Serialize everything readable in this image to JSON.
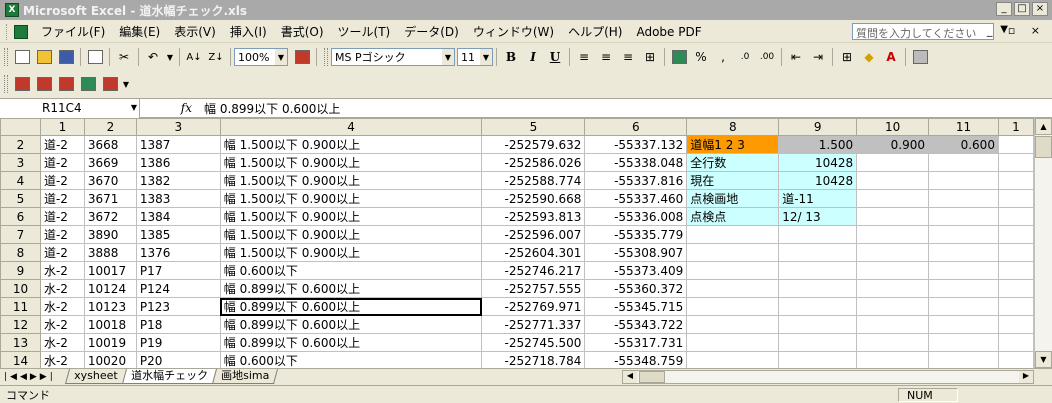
{
  "window": {
    "title": "Microsoft Excel - 道水幅チェック.xls",
    "app_icon": "excel-icon"
  },
  "menu": {
    "items": [
      "ファイル(F)",
      "編集(E)",
      "表示(V)",
      "挿入(I)",
      "書式(O)",
      "ツール(T)",
      "データ(D)",
      "ウィンドウ(W)",
      "ヘルプ(H)",
      "Adobe PDF"
    ],
    "help_placeholder": "質問を入力してください"
  },
  "toolbar": {
    "zoom": "100%",
    "font_name": "MS Pゴシック",
    "font_size": "11",
    "bold": "B",
    "italic": "I",
    "underline": "U",
    "percent": "%",
    "comma": ","
  },
  "formula_bar": {
    "name_box": "R11C4",
    "fx": "fx",
    "value": "幅 0.899以下 0.600以上"
  },
  "grid": {
    "col_headers": [
      "1",
      "2",
      "3",
      "4",
      "5",
      "6",
      "8",
      "9",
      "10",
      "11",
      "1"
    ],
    "rows": [
      {
        "n": "2",
        "c1": "道-2",
        "c2": "3668",
        "c3": "1387",
        "c4": "幅  1.500以下  0.900以上",
        "c5": "-252579.632",
        "c6": "-55337.132"
      },
      {
        "n": "3",
        "c1": "道-2",
        "c2": "3669",
        "c3": "1386",
        "c4": "幅  1.500以下  0.900以上",
        "c5": "-252586.026",
        "c6": "-55338.048"
      },
      {
        "n": "4",
        "c1": "道-2",
        "c2": "3670",
        "c3": "1382",
        "c4": "幅  1.500以下  0.900以上",
        "c5": "-252588.774",
        "c6": "-55337.816"
      },
      {
        "n": "5",
        "c1": "道-2",
        "c2": "3671",
        "c3": "1383",
        "c4": "幅  1.500以下  0.900以上",
        "c5": "-252590.668",
        "c6": "-55337.460"
      },
      {
        "n": "6",
        "c1": "道-2",
        "c2": "3672",
        "c3": "1384",
        "c4": "幅  1.500以下  0.900以上",
        "c5": "-252593.813",
        "c6": "-55336.008"
      },
      {
        "n": "7",
        "c1": "道-2",
        "c2": "3890",
        "c3": "1385",
        "c4": "幅  1.500以下  0.900以上",
        "c5": "-252596.007",
        "c6": "-55335.779"
      },
      {
        "n": "8",
        "c1": "道-2",
        "c2": "3888",
        "c3": "1376",
        "c4": "幅  1.500以下  0.900以上",
        "c5": "-252604.301",
        "c6": "-55308.907"
      },
      {
        "n": "9",
        "c1": "水-2",
        "c2": "10017",
        "c3": "P17",
        "c4": "幅  0.600以下",
        "c5": "-252746.217",
        "c6": "-55373.409"
      },
      {
        "n": "10",
        "c1": "水-2",
        "c2": "10124",
        "c3": "P124",
        "c4": "幅  0.899以下  0.600以上",
        "c5": "-252757.555",
        "c6": "-55360.372"
      },
      {
        "n": "11",
        "c1": "水-2",
        "c2": "10123",
        "c3": "P123",
        "c4": "幅  0.899以下  0.600以上",
        "c5": "-252769.971",
        "c6": "-55345.715"
      },
      {
        "n": "12",
        "c1": "水-2",
        "c2": "10018",
        "c3": "P18",
        "c4": "幅  0.899以下  0.600以上",
        "c5": "-252771.337",
        "c6": "-55343.722"
      },
      {
        "n": "13",
        "c1": "水-2",
        "c2": "10019",
        "c3": "P19",
        "c4": "幅  0.899以下  0.600以上",
        "c5": "-252745.500",
        "c6": "-55317.731"
      },
      {
        "n": "14",
        "c1": "水-2",
        "c2": "10020",
        "c3": "P20",
        "c4": "幅  0.600以下",
        "c5": "-252718.784",
        "c6": "-55348.759"
      }
    ],
    "side": {
      "r2_c8": "道幅1 2 3",
      "r2_c9": "1.500",
      "r2_c10": "0.900",
      "r2_c11": "0.600",
      "r3_c8": "全行数",
      "r3_c9": "10428",
      "r4_c8": "現在",
      "r4_c9": "10428",
      "r5_c8": "点検画地",
      "r5_c9": "道-11",
      "r6_c8": "点検点",
      "r6_c9": "12/ 13"
    }
  },
  "sheets": {
    "tabs": [
      "xysheet",
      "道水幅チェック",
      "画地sima"
    ],
    "active": "道水幅チェック"
  },
  "status": {
    "left": "コマンド",
    "num": "NUM"
  },
  "colors": {
    "orange": "#ff9900",
    "cyan": "#ccffff",
    "gray": "#c0c0c0"
  }
}
